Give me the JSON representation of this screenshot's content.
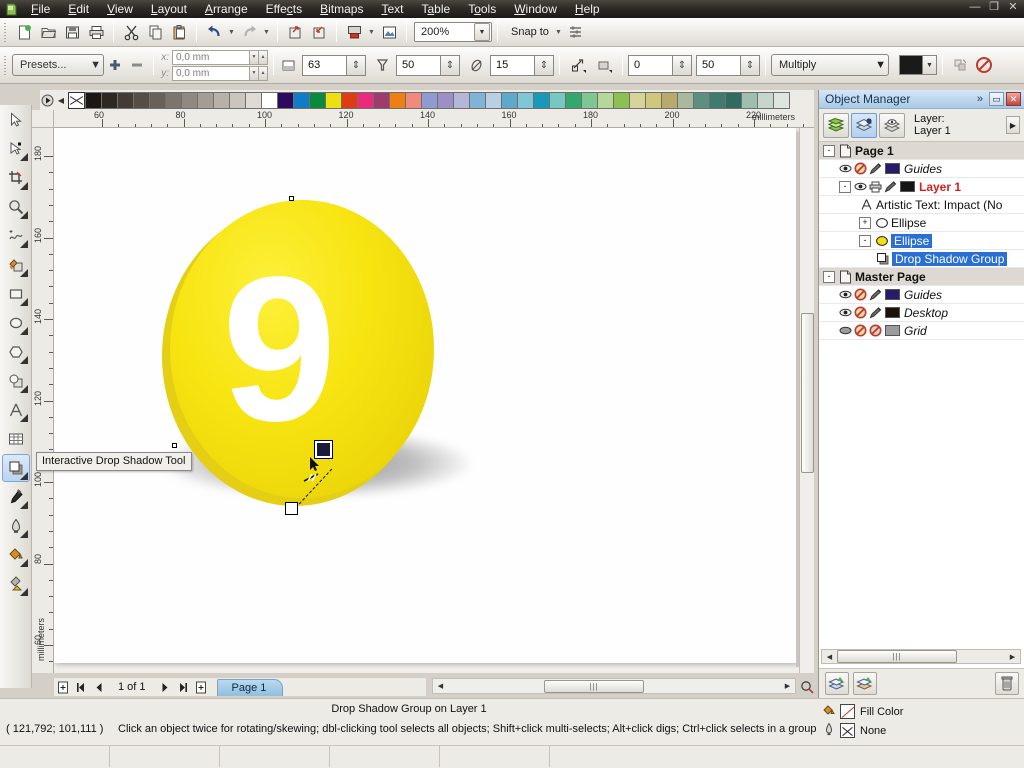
{
  "app": {
    "title": "CorelDRAW"
  },
  "menubar": {
    "items": [
      {
        "label": "File",
        "accel": "F"
      },
      {
        "label": "Edit",
        "accel": "E"
      },
      {
        "label": "View",
        "accel": "V"
      },
      {
        "label": "Layout",
        "accel": "L"
      },
      {
        "label": "Arrange",
        "accel": "A"
      },
      {
        "label": "Effects",
        "accel": "c"
      },
      {
        "label": "Bitmaps",
        "accel": "B"
      },
      {
        "label": "Text",
        "accel": "T"
      },
      {
        "label": "Table",
        "accel": "a"
      },
      {
        "label": "Tools",
        "accel": "o"
      },
      {
        "label": "Window",
        "accel": "W"
      },
      {
        "label": "Help",
        "accel": "H"
      }
    ],
    "window_buttons": [
      "minimize",
      "restore",
      "close"
    ]
  },
  "toolbar": {
    "buttons": [
      "new",
      "open",
      "save",
      "print",
      "cut",
      "copy",
      "paste",
      "undo",
      "redo",
      "import",
      "export",
      "publish-pdf",
      "application-launcher"
    ],
    "zoom_level": "200%",
    "snap_to_label": "Snap to",
    "options_label": "Options"
  },
  "propertybar": {
    "presets_label": "Presets...",
    "add_preset": "+",
    "remove_preset": "-",
    "x_label": "x:",
    "y_label": "y:",
    "x_value": "0,0 mm",
    "y_value": "0,0 mm",
    "shadow_opacity": "63",
    "shadow_feathering": "50",
    "shadow_feather_direction_value": "15",
    "shadow_offset_a": "0",
    "shadow_offset_b": "50",
    "merge_mode": "Multiply",
    "shadow_color": "#1a1a1a",
    "copy_properties_label": "Copy Shadow Properties",
    "clear_label": "Clear Shadow"
  },
  "toolbox": {
    "tools": [
      {
        "name": "pick-tool",
        "active": false
      },
      {
        "name": "shape-tool",
        "active": false
      },
      {
        "name": "crop-tool",
        "active": false
      },
      {
        "name": "zoom-tool",
        "active": false
      },
      {
        "name": "freehand-tool",
        "active": false
      },
      {
        "name": "smart-fill-tool",
        "active": false
      },
      {
        "name": "rectangle-tool",
        "active": false
      },
      {
        "name": "ellipse-tool",
        "active": false
      },
      {
        "name": "polygon-tool",
        "active": false
      },
      {
        "name": "basic-shapes-tool",
        "active": false
      },
      {
        "name": "text-tool",
        "active": false
      },
      {
        "name": "table-tool",
        "active": false
      },
      {
        "name": "interactive-drop-shadow-tool",
        "active": true
      },
      {
        "name": "eyedropper-tool",
        "active": false
      },
      {
        "name": "outline-tool",
        "active": false
      },
      {
        "name": "fill-tool",
        "active": false
      },
      {
        "name": "interactive-fill-tool",
        "active": false
      }
    ],
    "tooltip": "Interactive Drop Shadow Tool"
  },
  "rulers": {
    "unit": "millimeters",
    "horizontal_labels": [
      "60",
      "80",
      "100",
      "120",
      "140",
      "160",
      "180",
      "200",
      "220"
    ],
    "vertical_labels": [
      "180",
      "160",
      "140",
      "120",
      "100",
      "80",
      "60"
    ]
  },
  "palette": {
    "grays": [
      "#1c1713",
      "#2e2822",
      "#423c35",
      "#544e46",
      "#67615a",
      "#7b756e",
      "#8f8982",
      "#a39d96",
      "#b7b1aa",
      "#cbc5bf",
      "#dfdad4",
      "#ffffff"
    ],
    "colors": [
      "#2c0a5e",
      "#0f7cc8",
      "#0a8a3c",
      "#ecdf12",
      "#e03c12",
      "#ec2a7b",
      "#9e3a6e",
      "#ef7f13",
      "#ef8a7c",
      "#8e9ad0",
      "#9b8fc6",
      "#b4b7d8",
      "#7fb4d8",
      "#b9cfe3",
      "#5ea9c9",
      "#7fc6d8",
      "#1898bb",
      "#75c9c2",
      "#34a86a",
      "#7ec692",
      "#b6d79a",
      "#8cc152",
      "#d7d49a",
      "#cfc77a",
      "#b9a96a",
      "#a8b9a0",
      "#5b8f7e",
      "#3e7b6e",
      "#2f6b5e",
      "#9fbfae",
      "#c7d6cd",
      "#dfe6e0"
    ]
  },
  "canvas": {
    "artwork": {
      "shape": "ellipse",
      "fill_color": "#f4e112",
      "back_color": "#e4cf14",
      "number_label": "9",
      "number_color": "#ffffff",
      "shadow": "drop-shadow"
    }
  },
  "docker": {
    "title": "Object Manager",
    "layer_caption_line1": "Layer:",
    "layer_caption_line2": "Layer 1",
    "tool_buttons": [
      "show-object-properties",
      "edit-across-layers",
      "layer-manager-view"
    ],
    "tree": [
      {
        "level": 0,
        "label": "Page 1",
        "type": "page",
        "band": true,
        "expander": "-"
      },
      {
        "level": 1,
        "label": "Guides",
        "type": "layer",
        "italic": true,
        "color": "#2a1a6b",
        "icons": [
          "eye",
          "print-disabled",
          "pencil"
        ]
      },
      {
        "level": 1,
        "label": "Layer 1",
        "type": "layer",
        "color": "#141414",
        "red": true,
        "expander": "-",
        "icons": [
          "eye",
          "print",
          "pencil"
        ]
      },
      {
        "level": 2,
        "label": "Artistic Text: Impact (No",
        "type": "text-object"
      },
      {
        "level": 2,
        "label": "Ellipse",
        "type": "ellipse-object",
        "expander": "+"
      },
      {
        "level": 2,
        "label": "Ellipse",
        "type": "ellipse-object-filled",
        "expander": "-",
        "selected": true
      },
      {
        "level": 3,
        "label": "Drop Shadow Group",
        "type": "shadow-object",
        "selected": true
      },
      {
        "level": 0,
        "label": "Master Page",
        "type": "page",
        "band": true,
        "expander": "-"
      },
      {
        "level": 1,
        "label": "Guides",
        "type": "layer",
        "italic": true,
        "color": "#2a1a6b",
        "icons": [
          "eye",
          "print-disabled",
          "pencil"
        ]
      },
      {
        "level": 1,
        "label": "Desktop",
        "type": "layer",
        "italic": true,
        "color": "#1d1208",
        "icons": [
          "eye",
          "print-disabled",
          "pencil"
        ]
      },
      {
        "level": 1,
        "label": "Grid",
        "type": "layer",
        "italic": true,
        "color": "#9c9c9c",
        "icons": [
          "eye-off",
          "print-disabled",
          "edit-disabled"
        ]
      }
    ],
    "footer_buttons": [
      "new-layer",
      "new-master-layer",
      "delete-layer"
    ]
  },
  "pagenav": {
    "first_label": "first-page",
    "prev_label": "previous-page",
    "count_label": "1 of 1",
    "next_label": "next-page",
    "last_label": "last-page",
    "add_page_label": "add-page",
    "tabs": [
      {
        "label": "Page 1",
        "active": true
      }
    ]
  },
  "statusbar": {
    "object_info": "Drop Shadow Group on Layer 1",
    "coordinates": "( 121,792; 101,111 )",
    "hint": "Click an object twice for rotating/skewing; dbl-clicking tool selects all objects; Shift+click multi-selects; Alt+click digs; Ctrl+click selects in a group",
    "fill_label": "Fill Color",
    "outline_label": "None"
  }
}
